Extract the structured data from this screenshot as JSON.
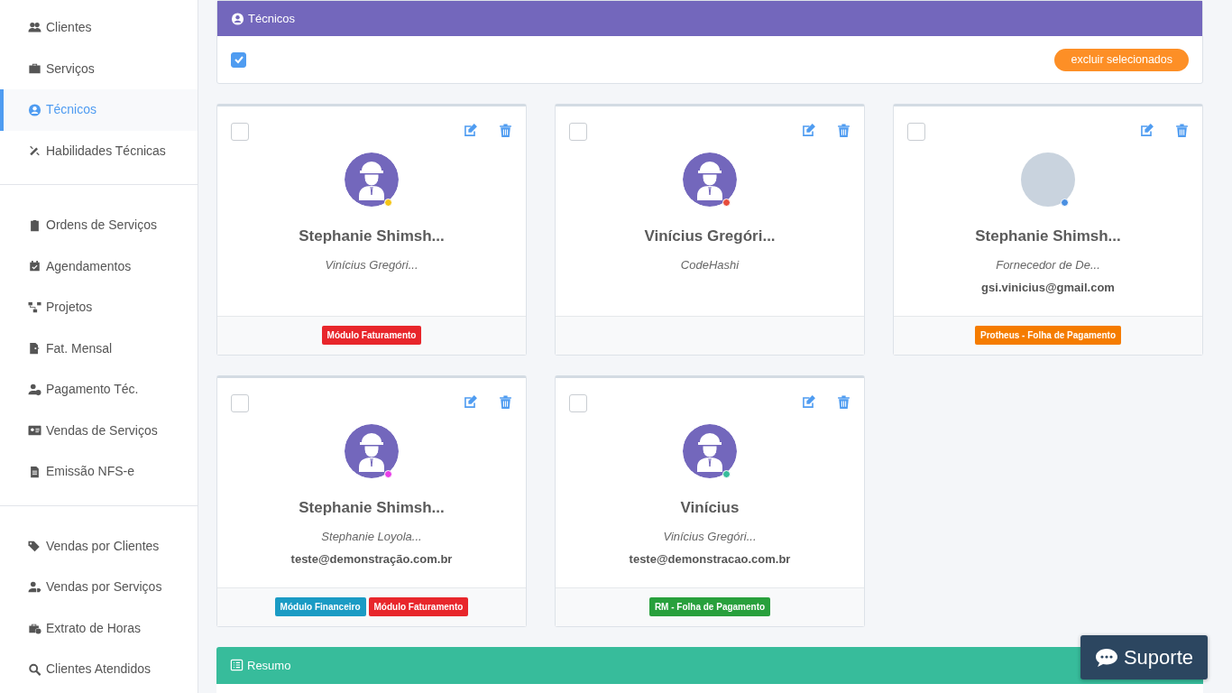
{
  "sidebar": {
    "groups": [
      {
        "items": [
          {
            "label": "Clientes",
            "selected": false
          },
          {
            "label": "Serviços",
            "selected": false
          },
          {
            "label": "Técnicos",
            "selected": true
          },
          {
            "label": "Habilidades Técnicas",
            "selected": false
          }
        ]
      },
      {
        "items": [
          {
            "label": "Ordens de Serviços",
            "selected": false
          },
          {
            "label": "Agendamentos",
            "selected": false
          },
          {
            "label": "Projetos",
            "selected": false
          },
          {
            "label": "Fat. Mensal",
            "selected": false
          },
          {
            "label": "Pagamento Téc.",
            "selected": false
          },
          {
            "label": "Vendas de Serviços",
            "selected": false
          },
          {
            "label": "Emissão NFS-e",
            "selected": false
          }
        ]
      },
      {
        "items": [
          {
            "label": "Vendas por Clientes",
            "selected": false
          },
          {
            "label": "Vendas por Serviços",
            "selected": false
          },
          {
            "label": "Extrato de Horas",
            "selected": false
          },
          {
            "label": "Clientes Atendidos",
            "selected": false
          }
        ]
      }
    ]
  },
  "panel": {
    "title": "Técnicos",
    "select_all": {
      "checked": true
    },
    "delete_button": "excluir selecionados"
  },
  "technicians": [
    {
      "checked": false,
      "kind": "icon",
      "color": "#f5c518",
      "name": "Stephanie Shimsh...",
      "subtitle": "Vinícius Gregóri...",
      "tags": [
        {
          "label": "Módulo Faturamento",
          "color": "#e8262b"
        }
      ]
    },
    {
      "checked": false,
      "kind": "icon",
      "color": "#e74c3c",
      "name": "Vinícius Gregóri...",
      "subtitle": "CodeHashi"
    },
    {
      "checked": false,
      "kind": "photo",
      "color": "#4a90e2",
      "name": "Stephanie Shimsh...",
      "subtitle": "Fornecedor de De...",
      "email": "gsi.vinicius@gmail.com",
      "tags": [
        {
          "label": "Protheus - Folha de Pagamento",
          "color": "#f57c00"
        }
      ]
    },
    {
      "checked": false,
      "kind": "icon",
      "color": "#e83ee8",
      "name": "Stephanie Shimsh...",
      "subtitle": "Stephanie Loyola...",
      "email": "teste@demonstração.com.br",
      "tags": [
        {
          "label": "Módulo Financeiro",
          "color": "#1a9bc4"
        },
        {
          "label": "Módulo Faturamento",
          "color": "#e8262b"
        }
      ]
    },
    {
      "checked": false,
      "kind": "icon",
      "color": "#37bc9b",
      "name": "Vinícius",
      "subtitle": "Vinícius Gregóri...",
      "email": "teste@demonstracao.com.br",
      "tags": [
        {
          "label": "RM - Folha de Pagamento",
          "color": "#28a03c"
        }
      ]
    }
  ],
  "summary": {
    "title": "Resumo"
  },
  "support_button": "Suporte"
}
